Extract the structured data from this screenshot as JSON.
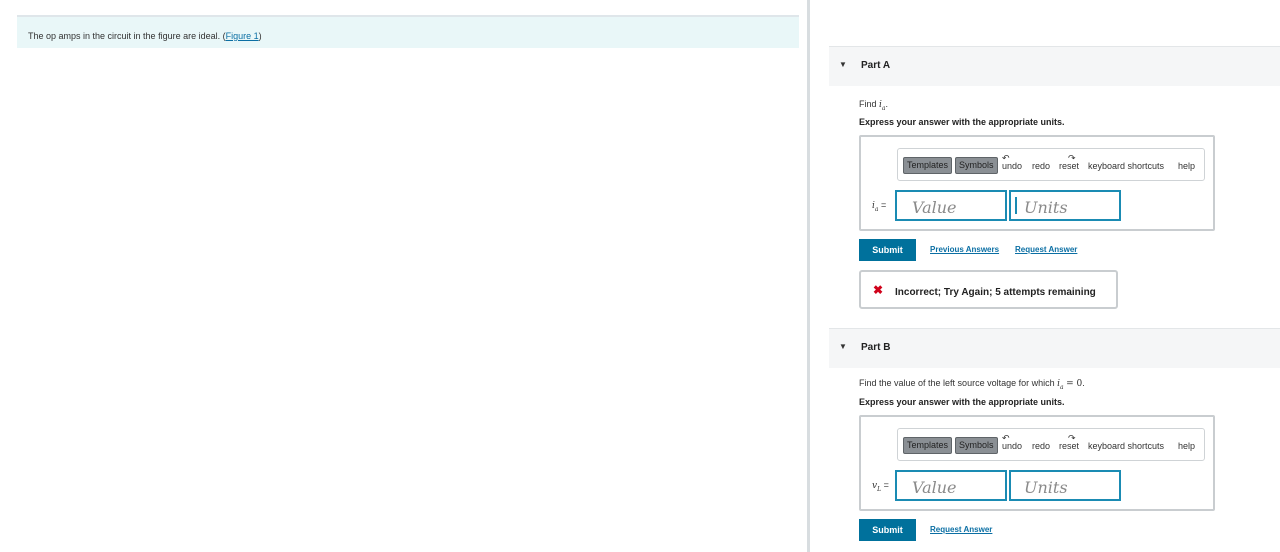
{
  "intro": {
    "text_before": "The op amps in the circuit in the figure are ideal. (",
    "figure_link": "Figure 1",
    "text_after": ")"
  },
  "toolbar": {
    "templates_label": "Templates",
    "symbols_label": "Symbols",
    "undo_label": "undo",
    "redo_label": "redo",
    "reset_label": "reset",
    "keyboard_label": "keyboard shortcuts",
    "help_label": "help"
  },
  "inputs": {
    "value_placeholder": "Value",
    "units_placeholder": "Units"
  },
  "partA": {
    "title": "Part A",
    "prompt_prefix": "Find",
    "prompt_var": "i",
    "prompt_sub": "a",
    "prompt_suffix": ".",
    "instruction": "Express your answer with the appropriate units.",
    "var_symbol": "i",
    "var_sub": "a",
    "var_eq": "=",
    "submit_label": "Submit",
    "previous_answers_label": "Previous Answers",
    "request_answer_label": "Request Answer",
    "feedback_icon": "✖",
    "feedback_text": "Incorrect; Try Again; 5 attempts remaining"
  },
  "partB": {
    "title": "Part B",
    "prompt_prefix": "Find the value of the left source voltage for which",
    "prompt_var": "i",
    "prompt_sub": "a",
    "prompt_eq": "= 0",
    "prompt_suffix": ".",
    "instruction": "Express your answer with the appropriate units.",
    "var_symbol": "v",
    "var_sub": "L",
    "var_eq": "=",
    "submit_label": "Submit",
    "request_answer_label": "Request Answer"
  },
  "icons": {
    "caret": "▼",
    "undo_glyph": "↶",
    "redo_glyph": "↷"
  },
  "colors": {
    "accent": "#00719c",
    "link": "#0b6fa4",
    "error": "#d0021b",
    "input_border": "#1a8bb3"
  }
}
